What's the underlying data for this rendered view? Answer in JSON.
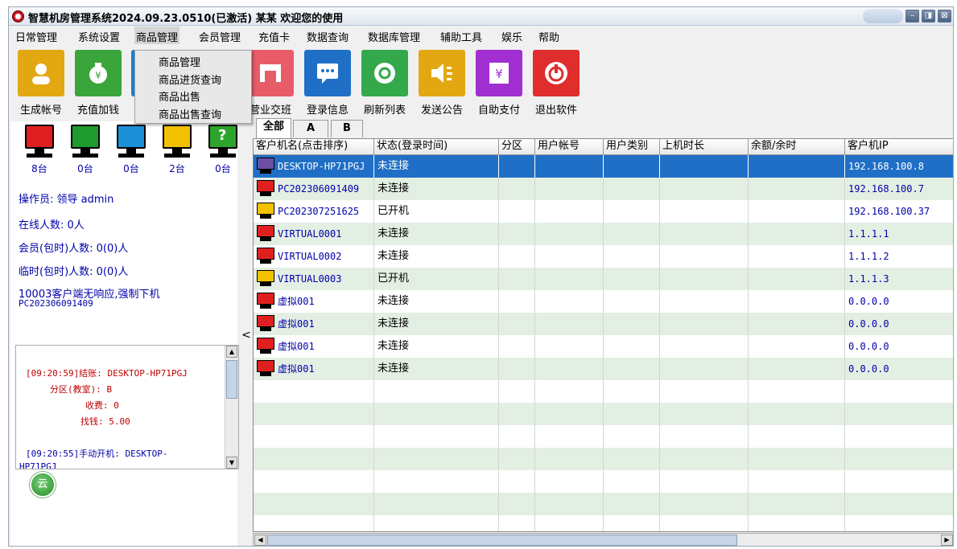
{
  "window": {
    "title": "智慧机房管理系统2024.09.23.0510(已激活)  某某 欢迎您的使用",
    "min_label": "–",
    "max_label": "◨",
    "close_label": "⊠"
  },
  "menu": [
    "日常管理",
    "系统设置",
    "商品管理",
    "会员管理",
    "充值卡",
    "数据查询",
    "数据库管理",
    "辅助工具",
    "娱乐",
    "帮助"
  ],
  "dropdown": [
    "商品管理",
    "商品进货查询",
    "商品出售",
    "商品出售查询"
  ],
  "toolbar": [
    {
      "label": "生成帐号",
      "color": "#e3a711",
      "icon": "user-icon"
    },
    {
      "label": "充值加钱",
      "color": "#3aa53a",
      "icon": "money-bag-icon"
    },
    {
      "label": "",
      "color": "#1a7fd0",
      "icon": "hidden-tool-icon"
    },
    {
      "label": "营业交班",
      "color": "#e85c6a",
      "icon": "shift-icon"
    },
    {
      "label": "登录信息",
      "color": "#1f6fc6",
      "icon": "chat-icon"
    },
    {
      "label": "刷新列表",
      "color": "#34a94b",
      "icon": "refresh-icon"
    },
    {
      "label": "发送公告",
      "color": "#e3a711",
      "icon": "speaker-icon"
    },
    {
      "label": "自助支付",
      "color": "#a12fd1",
      "icon": "yen-icon"
    },
    {
      "label": "退出软件",
      "color": "#e02d2d",
      "icon": "power-icon"
    }
  ],
  "status_towers": [
    {
      "color": "#e02020",
      "count": "8台"
    },
    {
      "color": "#1f9a2f",
      "count": "0台"
    },
    {
      "color": "#1a8fd8",
      "count": "0台"
    },
    {
      "color": "#f2c200",
      "count": "2台"
    },
    {
      "color": "#2da52d",
      "count": "0台",
      "badge": "?"
    }
  ],
  "left_info": {
    "operator": "操作员: 领导 admin",
    "online": "在线人数: 0人",
    "member": "会员(包时)人数: 0(0)人",
    "temp": "临时(包时)人数: 0(0)人",
    "notice1": "10003客户端无响应,强制下机",
    "notice2": "PC202306091409"
  },
  "log": [
    {
      "text": "[09:20:59]结账: DESKTOP-HP71PGJ",
      "color": "#c00000"
    },
    {
      "text": "分区(教室): B",
      "color": "#c00000"
    },
    {
      "text": "收费: 0",
      "color": "#c00000"
    },
    {
      "text": "找钱: 5.00",
      "color": "#c00000"
    },
    {
      "text": "[09:20:55]手动开机: DESKTOP-",
      "color": "#0000aa"
    },
    {
      "text": "HP71PGJ",
      "color": "#0000aa"
    }
  ],
  "cloud_label": "云",
  "collapse_label": "<",
  "tabs": [
    "全部",
    "A",
    "B"
  ],
  "columns": [
    "客户机名(点击排序)",
    "状态(登录时间)",
    "分区",
    "用户帐号",
    "用户类别",
    "上机时长",
    "余额/余时",
    "客户机IP"
  ],
  "rows": [
    {
      "name": "DESKTOP-HP71PGJ",
      "status": "未连接",
      "ip": "192.168.100.8",
      "color": "#6a4fa3"
    },
    {
      "name": "PC202306091409",
      "status": "未连接",
      "ip": "192.168.100.7",
      "color": "#e02020"
    },
    {
      "name": "PC202307251625",
      "status": "已开机",
      "ip": "192.168.100.37",
      "color": "#f2c200"
    },
    {
      "name": "VIRTUAL0001",
      "status": "未连接",
      "ip": "1.1.1.1",
      "color": "#e02020"
    },
    {
      "name": "VIRTUAL0002",
      "status": "未连接",
      "ip": "1.1.1.2",
      "color": "#e02020"
    },
    {
      "name": "VIRTUAL0003",
      "status": "已开机",
      "ip": "1.1.1.3",
      "color": "#f2c200"
    },
    {
      "name": "虚拟001",
      "status": "未连接",
      "ip": "0.0.0.0",
      "color": "#e02020"
    },
    {
      "name": "虚拟001",
      "status": "未连接",
      "ip": "0.0.0.0",
      "color": "#e02020"
    },
    {
      "name": "虚拟001",
      "status": "未连接",
      "ip": "0.0.0.0",
      "color": "#e02020"
    },
    {
      "name": "虚拟001",
      "status": "未连接",
      "ip": "0.0.0.0",
      "color": "#e02020"
    }
  ]
}
